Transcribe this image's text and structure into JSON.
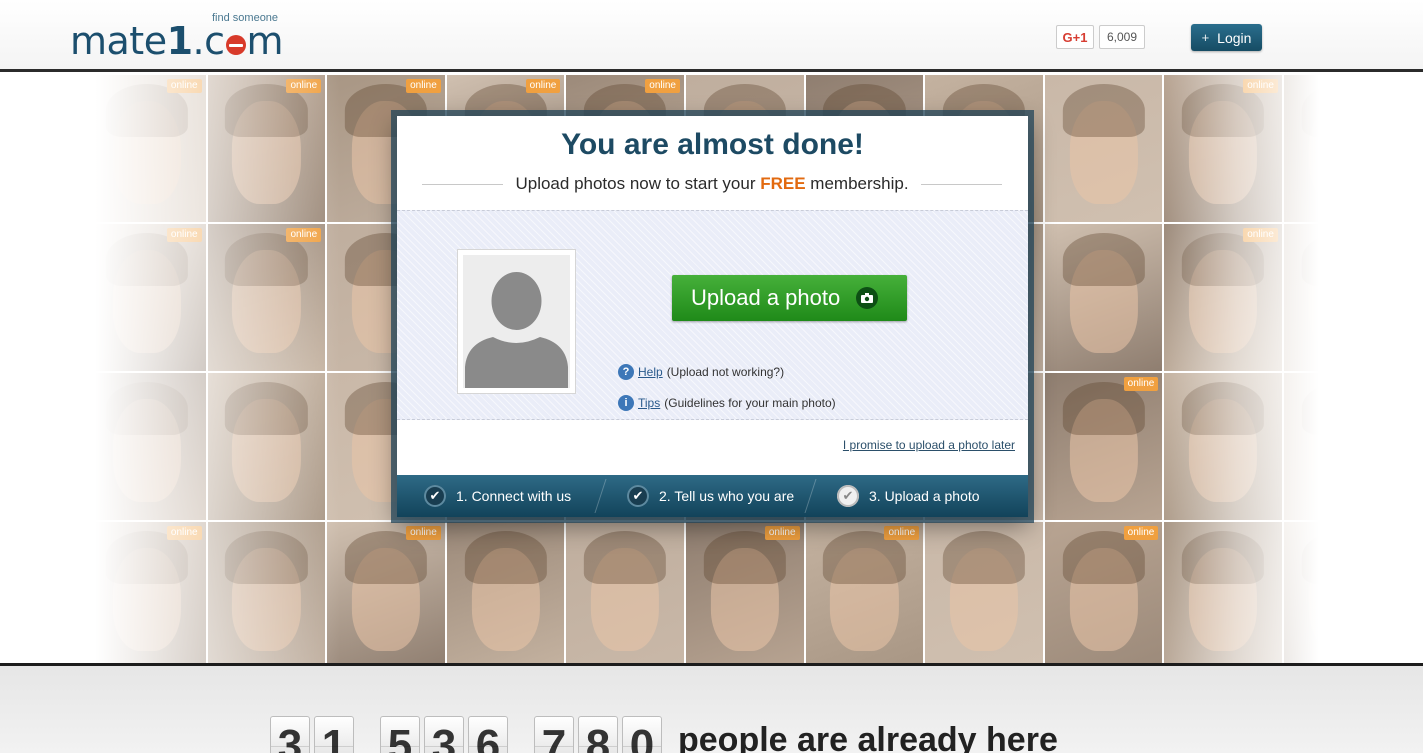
{
  "header": {
    "logo_text": "mate",
    "logo_one": "1",
    "logo_dot": ".c",
    "logo_end": "m",
    "tagline": "find someone",
    "gplus_label": "G+1",
    "gplus_count": "6,009",
    "login_label": "Login"
  },
  "grid": {
    "online_badge": "online",
    "tiles": [
      {
        "online": true
      },
      {
        "online": true
      },
      {
        "online": true
      },
      {
        "online": true
      },
      {
        "online": true
      },
      {
        "online": false
      },
      {
        "online": false
      },
      {
        "online": false
      },
      {
        "online": false
      },
      {
        "online": true
      },
      {
        "online": false
      },
      {
        "online": true
      },
      {
        "online": true
      },
      {
        "online": false
      },
      {
        "online": false
      },
      {
        "online": false
      },
      {
        "online": false
      },
      {
        "online": false
      },
      {
        "online": false
      },
      {
        "online": false
      },
      {
        "online": true
      },
      {
        "online": false
      },
      {
        "online": false
      },
      {
        "online": false
      },
      {
        "online": false
      },
      {
        "online": false
      },
      {
        "online": false
      },
      {
        "online": false
      },
      {
        "online": false
      },
      {
        "online": false
      },
      {
        "online": true
      },
      {
        "online": false
      },
      {
        "online": false
      },
      {
        "online": true
      },
      {
        "online": false
      },
      {
        "online": true
      },
      {
        "online": false
      },
      {
        "online": false
      },
      {
        "online": true
      },
      {
        "online": true
      },
      {
        "online": false
      },
      {
        "online": true
      },
      {
        "online": false
      },
      {
        "online": false
      }
    ]
  },
  "modal": {
    "title": "You are almost done!",
    "subtitle_before": "Upload photos now to start your ",
    "subtitle_free": "FREE",
    "subtitle_after": " membership.",
    "upload_button": "Upload a photo",
    "help_link": "Help",
    "help_note": "(Upload not working?)",
    "tips_link": "Tips",
    "tips_note": "(Guidelines for your main photo)",
    "later_link": "I promise to upload a photo later",
    "steps": [
      {
        "label": "1. Connect with us",
        "done": true
      },
      {
        "label": "2. Tell us who you are",
        "done": true
      },
      {
        "label": "3. Upload a photo",
        "done": false
      }
    ]
  },
  "counter": {
    "groups": [
      [
        "3",
        "1"
      ],
      [
        "5",
        "3",
        "6"
      ],
      [
        "7",
        "8",
        "0"
      ]
    ],
    "text": "people are already here"
  },
  "colors": {
    "brand": "#1c4f6e",
    "accent_green": "#2a9a22",
    "free_orange": "#e26a10",
    "online_orange": "#f0a040"
  }
}
